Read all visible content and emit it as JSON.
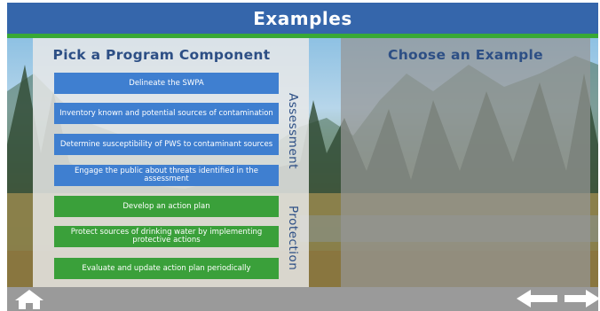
{
  "header": {
    "title": "Examples"
  },
  "left_panel": {
    "title": "Pick a Program Component",
    "groups": [
      {
        "label": "Assessment",
        "items": [
          {
            "label": "Delineate the SWPA"
          },
          {
            "label": "Inventory known and potential sources of contamination"
          },
          {
            "label": "Determine susceptibility of PWS to contaminant sources"
          },
          {
            "label": "Engage the public about threats identified in the assessment"
          }
        ]
      },
      {
        "label": "Protection",
        "items": [
          {
            "label": "Develop an action plan"
          },
          {
            "label": "Protect sources of drinking water by implementing protective actions"
          },
          {
            "label": "Evaluate and update action plan periodically"
          }
        ]
      }
    ]
  },
  "right_panel": {
    "title": "Choose an Example"
  },
  "footer": {
    "home_icon": "home-icon",
    "prev_icon": "left-arrow-icon",
    "next_icon": "right-arrow-icon"
  },
  "colors": {
    "header": "#3566ab",
    "accent_green": "#39a935",
    "assessment_button": "#3f7fd0",
    "protection_button": "#3aa03a",
    "title_text": "#2d4f85"
  }
}
